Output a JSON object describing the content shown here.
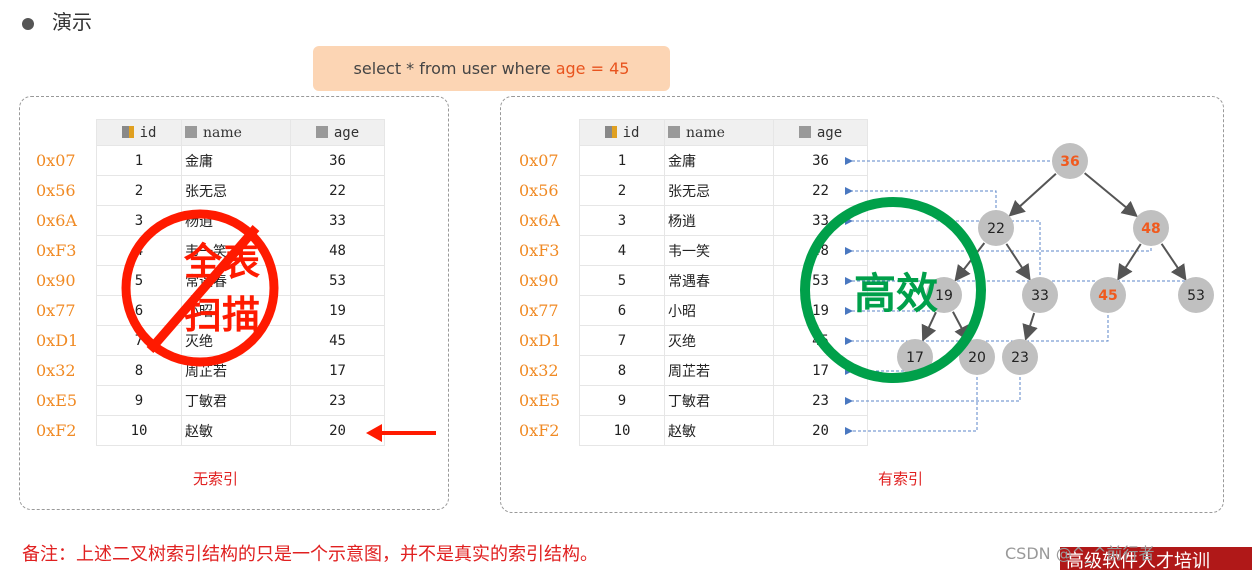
{
  "title": "演示",
  "sql": {
    "prefix": "select * from user where",
    "highlight": "age = 45"
  },
  "columns": [
    "id",
    "name",
    "age"
  ],
  "rows": [
    {
      "addr": "0x07",
      "id": "1",
      "name": "金庸",
      "age": "36"
    },
    {
      "addr": "0x56",
      "id": "2",
      "name": "张无忌",
      "age": "22"
    },
    {
      "addr": "0x6A",
      "id": "3",
      "name": "杨逍",
      "age": "33"
    },
    {
      "addr": "0xF3",
      "id": "4",
      "name": "韦一笑",
      "age": "48"
    },
    {
      "addr": "0x90",
      "id": "5",
      "name": "常遇春",
      "age": "53"
    },
    {
      "addr": "0x77",
      "id": "6",
      "name": "小昭",
      "age": "19"
    },
    {
      "addr": "0xD1",
      "id": "7",
      "name": "灭绝",
      "age": "45"
    },
    {
      "addr": "0x32",
      "id": "8",
      "name": "周芷若",
      "age": "17"
    },
    {
      "addr": "0xE5",
      "id": "9",
      "name": "丁敏君",
      "age": "23"
    },
    {
      "addr": "0xF2",
      "id": "10",
      "name": "赵敏",
      "age": "20"
    }
  ],
  "left_caption": "无索引",
  "right_caption": "有索引",
  "left_stamp": [
    "全表",
    "扫描"
  ],
  "right_stamp": "高效",
  "tree_nodes": [
    "36",
    "22",
    "48",
    "19",
    "33",
    "45",
    "53",
    "17",
    "20",
    "23"
  ],
  "highlight_nodes": [
    "36",
    "48",
    "45"
  ],
  "note": "备注：上述二叉树索引结构的只是一个示意图，并不是真实的索引结构。",
  "watermark": "CSDN @^_^前行者",
  "banner": "高级软件人才培训",
  "colors": {
    "stamp_red": "#ff1a00",
    "stamp_green": "#00a04a",
    "highlight": "#f05a1e",
    "address": "#f08a24",
    "node": "#c0c0c0",
    "dashed": "#5b86c8"
  }
}
